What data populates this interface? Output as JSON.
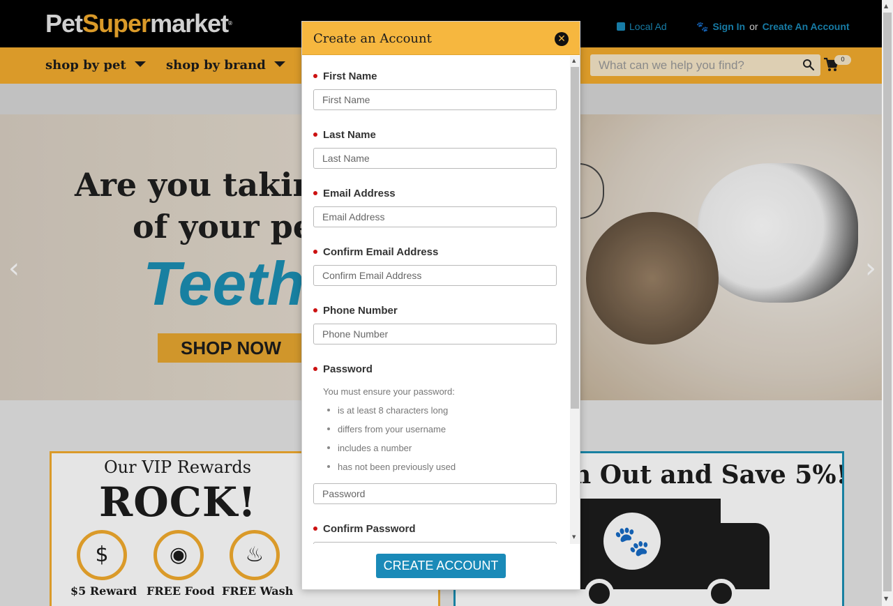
{
  "header": {
    "logo": {
      "part1": "Pet",
      "part2": "Super",
      "part3": "market",
      "tm": "®"
    },
    "links": {
      "local_ad": "Local Ad",
      "sign_in": "Sign In",
      "or": "or",
      "create_account": "Create An Account"
    }
  },
  "nav": {
    "items": [
      {
        "label": "shop by pet"
      },
      {
        "label": "shop by brand"
      }
    ],
    "search_placeholder": "What can we help you find?",
    "cart_count": "0"
  },
  "hero": {
    "line1": "Are you taking",
    "line2": "of your pet",
    "highlight": "Teeth?",
    "cta": "SHOP NOW"
  },
  "promos": {
    "vip": {
      "title": "Our VIP Rewards",
      "headline": "ROCK!",
      "badges": [
        {
          "label": "$5 Reward",
          "icon": "money-bag-icon",
          "glyph": "$"
        },
        {
          "label": "FREE Food",
          "icon": "dog-food-icon",
          "glyph": "◉"
        },
        {
          "label": "FREE Wash",
          "icon": "dog-wash-icon",
          "glyph": "♨"
        }
      ]
    },
    "autoship": {
      "title": "n Out and Save 5%!",
      "icon": "paw-icon"
    }
  },
  "modal": {
    "title": "Create an Account",
    "close_icon": "close-icon",
    "fields": [
      {
        "label": "First Name",
        "placeholder": "First Name"
      },
      {
        "label": "Last Name",
        "placeholder": "Last Name"
      },
      {
        "label": "Email Address",
        "placeholder": "Email Address"
      },
      {
        "label": "Confirm Email Address",
        "placeholder": "Confirm Email Address"
      },
      {
        "label": "Phone Number",
        "placeholder": "Phone Number"
      },
      {
        "label": "Password",
        "placeholder": "Password"
      },
      {
        "label": "Confirm Password",
        "placeholder": ""
      }
    ],
    "password_hint": "You must ensure your password:",
    "password_rules": [
      "is at least 8 characters long",
      "differs from your username",
      "includes a number",
      "has not been previously used"
    ],
    "submit_label": "CREATE ACCOUNT"
  },
  "colors": {
    "brand_orange": "#f3ac2e",
    "link_blue": "#1a8ab8",
    "required_red": "#cc1111"
  }
}
